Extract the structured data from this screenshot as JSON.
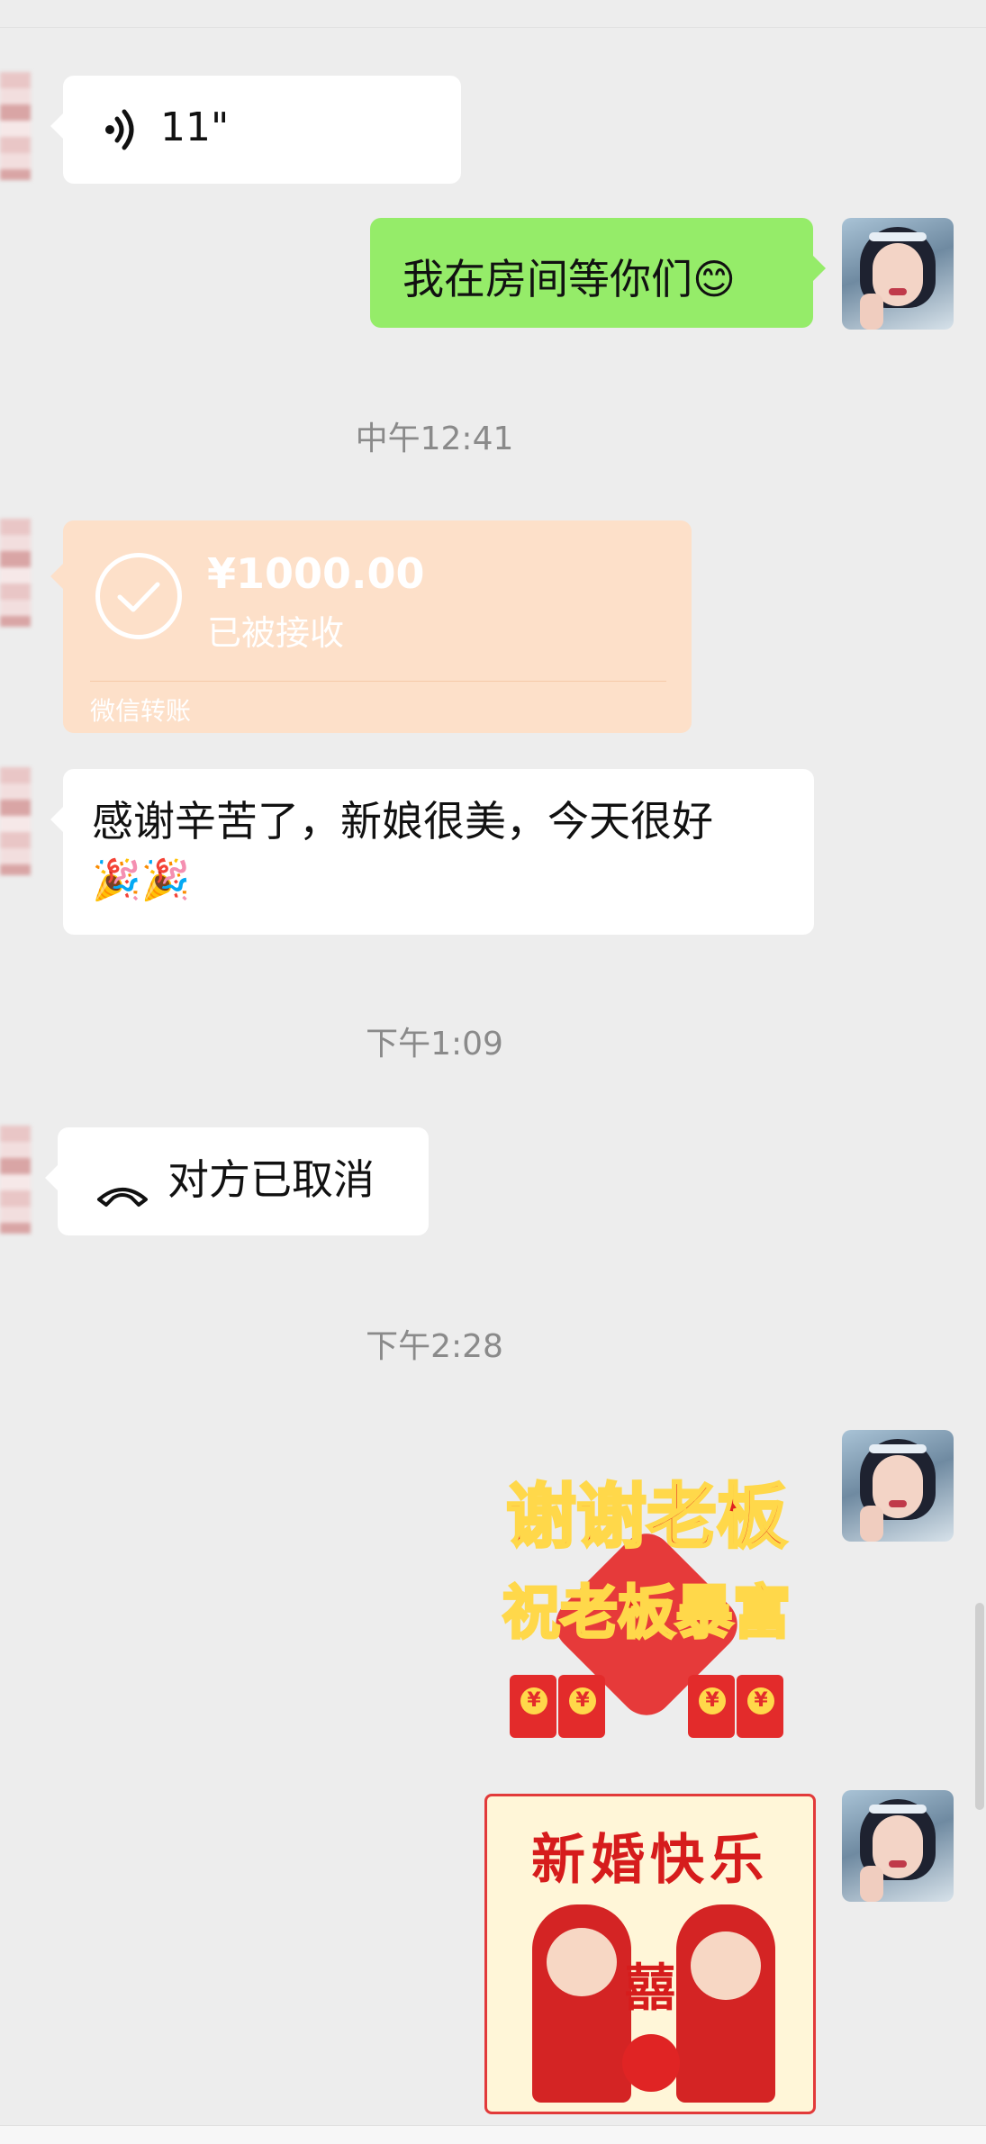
{
  "messages": {
    "voice": {
      "duration": "11\""
    },
    "sent1": {
      "text": "我在房间等你们😊"
    },
    "time1": "中午12:41",
    "transfer": {
      "amount": "¥1000.00",
      "status": "已被接收",
      "footer": "微信转账"
    },
    "thanks": {
      "text": "感谢辛苦了，新娘很美，今天很好",
      "emoji": "🎉🎉"
    },
    "time2": "下午1:09",
    "call": {
      "text": "对方已取消"
    },
    "time3": "下午2:28",
    "sticker1": {
      "line1": "谢谢老板",
      "line2": "祝老板暴富",
      "coin": "¥"
    },
    "sticker2": {
      "title": "新婚快乐",
      "stamp": "囍"
    }
  },
  "colors": {
    "background": "#ededed",
    "sent_bubble": "#95ec69",
    "received_bubble": "#ffffff",
    "transfer_bubble": "#fde0c9",
    "timestamp": "#8a8a8a"
  },
  "icons": [
    "voice-wave-icon",
    "check-circle-icon",
    "hangup-phone-icon",
    "smile-emoji",
    "party-popper-emoji"
  ]
}
